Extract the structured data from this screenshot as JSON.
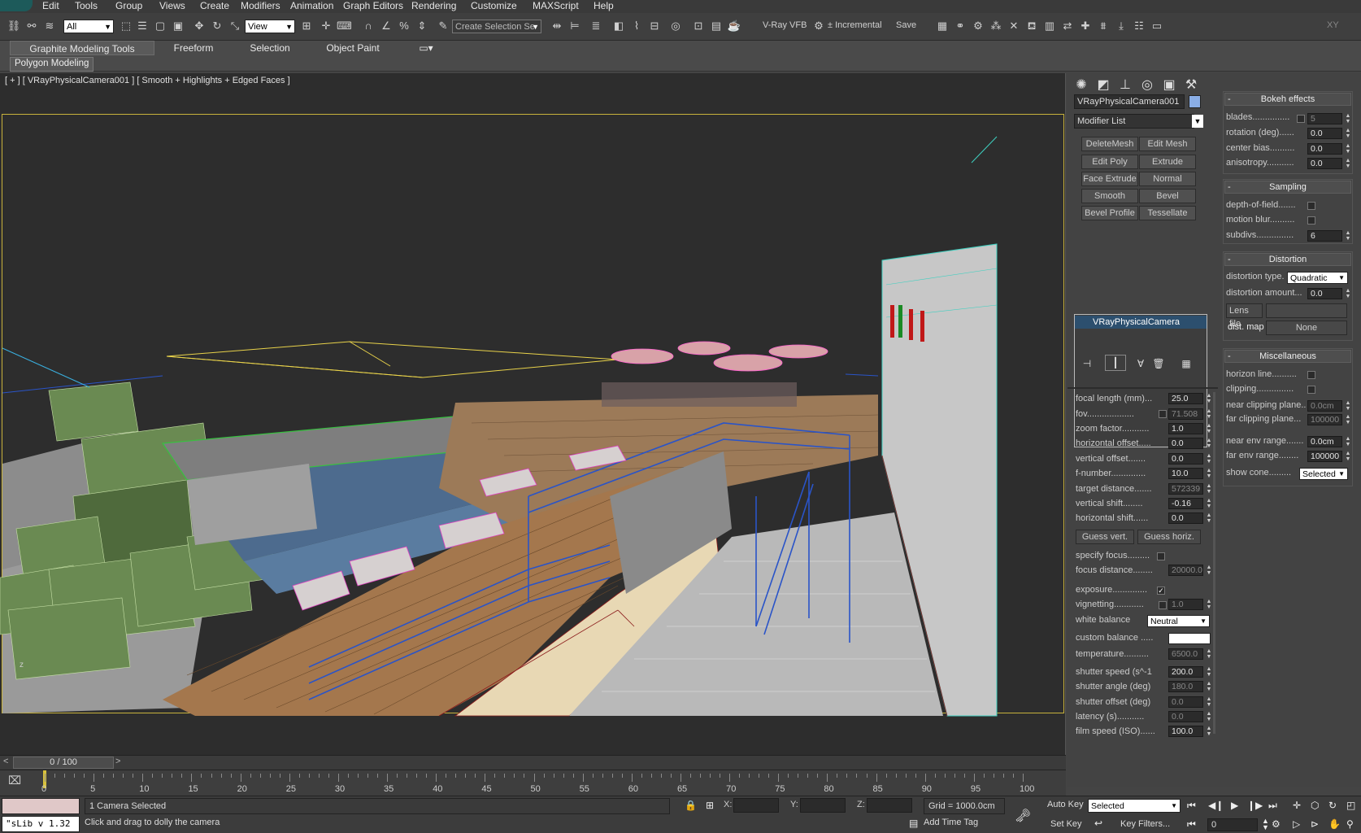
{
  "menu": [
    "Edit",
    "Tools",
    "Group",
    "Views",
    "Create",
    "Modifiers",
    "Animation",
    "Graph Editors",
    "Rendering",
    "Customize",
    "MAXScript",
    "Help"
  ],
  "toolbar": {
    "selection_filter": "All",
    "ref_coord": "View",
    "named_selection": "Create Selection Se",
    "vray_vfb": "V-Ray VFB",
    "incremental": "± Incremental",
    "save": "Save",
    "xy": "XY"
  },
  "ribbon": {
    "tabs": [
      "Graphite Modeling Tools",
      "Freeform",
      "Selection",
      "Object Paint"
    ],
    "sub_tab": "Polygon Modeling"
  },
  "viewport": {
    "label": "[ + ] [ VRayPhysicalCamera001 ] [ Smooth + Highlights + Edged Faces ]",
    "axis": "z",
    "colors": {
      "bg": "#2d2d2d",
      "frame": "#c8b23c"
    }
  },
  "command_panel": {
    "object_name": "VRayPhysicalCamera001",
    "object_color": "#8aaee6",
    "modifier_list": "Modifier List",
    "modifier_buttons": [
      "DeleteMesh",
      "Edit Mesh",
      "Edit Poly",
      "Extrude",
      "Face Extrude",
      "Normal",
      "Smooth",
      "Bevel",
      "Bevel Profile",
      "Tessellate"
    ],
    "stack_item": "VRayPhysicalCamera",
    "params": [
      {
        "label": "focal length (mm)...",
        "value": "25.0"
      },
      {
        "label": "fov...................",
        "value": "71.508",
        "check": true
      },
      {
        "label": "zoom factor...........",
        "value": "1.0"
      },
      {
        "label": "horizontal offset.....",
        "value": "0.0"
      },
      {
        "label": "vertical offset.......",
        "value": "0.0"
      },
      {
        "label": "f-number..............",
        "value": "10.0"
      },
      {
        "label": "target distance.......",
        "value": "572339"
      },
      {
        "label": "vertical shift........",
        "value": "-0.16"
      },
      {
        "label": "horizontal shift......",
        "value": "0.0"
      }
    ],
    "guess_vert": "Guess vert.",
    "guess_horiz": "Guess horiz.",
    "specify_focus": "specify focus.........",
    "focus_distance": {
      "label": "focus distance........",
      "value": "20000.0"
    },
    "exposure": "exposure..............",
    "vignetting": {
      "label": "vignetting............",
      "value": "1.0"
    },
    "white_balance": {
      "label": "white balance",
      "value": "Neutral"
    },
    "custom_balance": "custom balance .....",
    "params2": [
      {
        "label": "temperature..........",
        "value": "6500.0"
      },
      {
        "label": "shutter speed (s^-1",
        "value": "200.0"
      },
      {
        "label": "shutter angle (deg)",
        "value": "180.0"
      },
      {
        "label": "shutter offset (deg)",
        "value": "0.0"
      },
      {
        "label": "latency (s)...........",
        "value": "0.0"
      },
      {
        "label": "film speed (ISO)......",
        "value": "100.0"
      }
    ]
  },
  "right_panel": {
    "bokeh": {
      "title": "Bokeh effects",
      "rows": [
        {
          "label": "blades...............",
          "value": "5",
          "check": true
        },
        {
          "label": "rotation (deg)......",
          "value": "0.0"
        },
        {
          "label": "center bias..........",
          "value": "0.0"
        },
        {
          "label": "anisotropy...........",
          "value": "0.0"
        }
      ]
    },
    "sampling": {
      "title": "Sampling",
      "dof": "depth-of-field.......",
      "motion_blur": "motion blur..........",
      "subdivs": {
        "label": "subdivs...............",
        "value": "6"
      }
    },
    "distortion": {
      "title": "Distortion",
      "type_label": "distortion type.",
      "type_value": "Quadratic",
      "amount": {
        "label": "distortion amount...",
        "value": "0.0"
      },
      "lens_file": "Lens file",
      "dist_map": "dist. map",
      "none": "None"
    },
    "misc": {
      "title": "Miscellaneous",
      "horizon": "horizon line..........",
      "clipping": "clipping...............",
      "near_clip": {
        "label": "near clipping plane..",
        "value": "0.0cm"
      },
      "far_clip": {
        "label": "far clipping plane...",
        "value": "100000"
      },
      "near_env": {
        "label": "near env range.......",
        "value": "0.0cm"
      },
      "far_env": {
        "label": "far env range........",
        "value": "100000"
      },
      "show_cone": {
        "label": "show cone.........",
        "value": "Selected"
      }
    }
  },
  "timeline": {
    "slider": "0 / 100",
    "ticks": [
      "0",
      "5",
      "10",
      "15",
      "20",
      "25",
      "30",
      "35",
      "40",
      "45",
      "50",
      "55",
      "60",
      "65",
      "70",
      "75",
      "80",
      "85",
      "90",
      "95",
      "100"
    ]
  },
  "status": {
    "script_box": "\"sLib v 1.32",
    "selected": "1 Camera Selected",
    "prompt": "Click and drag to dolly the camera",
    "x": "X:",
    "y": "Y:",
    "z": "Z:",
    "grid": "Grid = 1000.0cm",
    "add_time_tag": "Add Time Tag",
    "auto_key": "Auto Key",
    "set_key": "Set Key",
    "key_mode": "Selected",
    "key_filters": "Key Filters...",
    "frame": "0"
  }
}
